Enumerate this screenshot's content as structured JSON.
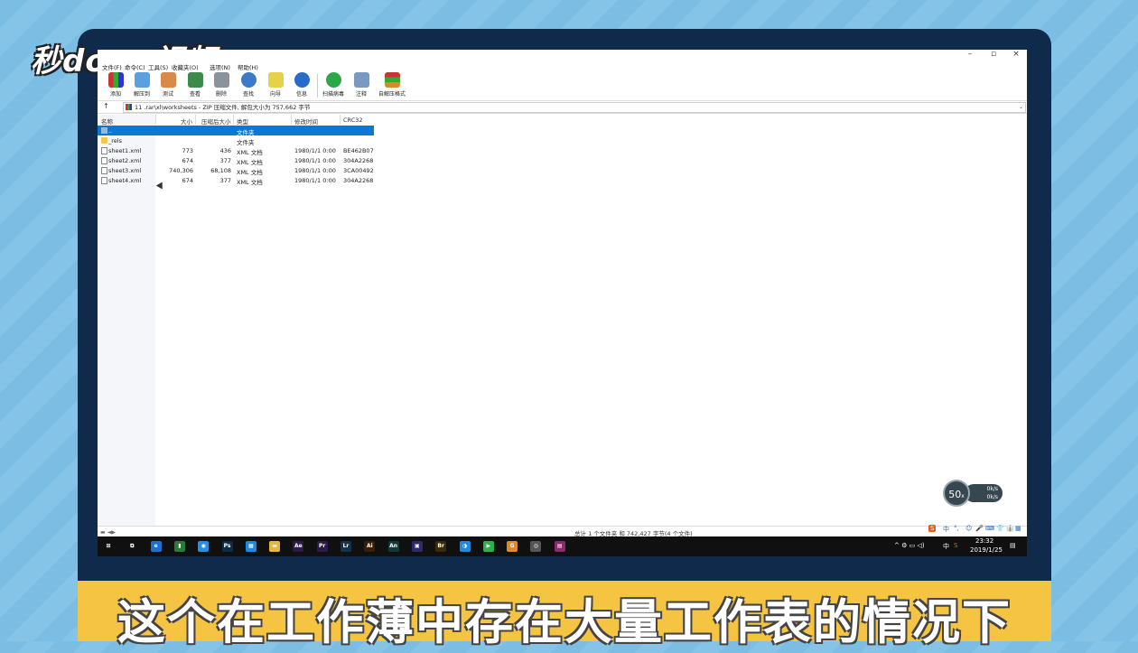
{
  "brand": {
    "logo_text": "秒dong视频"
  },
  "subtitle": "这个在工作薄中存在大量工作表的情况下",
  "window": {
    "controls": {
      "minimize": "–",
      "maximize": "▫",
      "close": "×"
    }
  },
  "menu": {
    "items": [
      "文件(F)",
      "命令(C)",
      "工具(S)",
      "收藏夹(O)",
      "选项(N)",
      "帮助(H)"
    ]
  },
  "toolbar": {
    "tools": [
      {
        "label": "添加",
        "icon": "add-archive-icon"
      },
      {
        "label": "解压到",
        "icon": "extract-to-icon"
      },
      {
        "label": "测试",
        "icon": "test-icon"
      },
      {
        "label": "查看",
        "icon": "view-icon"
      },
      {
        "label": "删除",
        "icon": "delete-icon"
      },
      {
        "label": "查找",
        "icon": "find-icon"
      },
      {
        "label": "向导",
        "icon": "wizard-icon"
      },
      {
        "label": "信息",
        "icon": "info-icon"
      },
      {
        "label": "扫描病毒",
        "icon": "virus-scan-icon"
      },
      {
        "label": "注释",
        "icon": "comment-icon"
      },
      {
        "label": "自解压格式",
        "icon": "sfx-icon"
      }
    ]
  },
  "address": {
    "up_label": "↑",
    "path": "11 .rar\\xl\\worksheets - ZIP 压缩文件, 解包大小为 757,662 字节"
  },
  "columns": [
    "名称",
    "大小",
    "压缩后大小",
    "类型",
    "修改时间",
    "CRC32"
  ],
  "files": [
    {
      "name": "..",
      "size": "",
      "packed": "",
      "type": "文件夹",
      "modified": "",
      "crc": "",
      "kind": "up",
      "selected": true
    },
    {
      "name": "_rels",
      "size": "",
      "packed": "",
      "type": "文件夹",
      "modified": "",
      "crc": "",
      "kind": "folder",
      "selected": false
    },
    {
      "name": "sheet1.xml",
      "size": "773",
      "packed": "436",
      "type": "XML 文档",
      "modified": "1980/1/1 0:00",
      "crc": "BE462B07",
      "kind": "file",
      "selected": false
    },
    {
      "name": "sheet2.xml",
      "size": "674",
      "packed": "377",
      "type": "XML 文档",
      "modified": "1980/1/1 0:00",
      "crc": "304A2268",
      "kind": "file",
      "selected": false
    },
    {
      "name": "sheet3.xml",
      "size": "740,306",
      "packed": "68,108",
      "type": "XML 文档",
      "modified": "1980/1/1 0:00",
      "crc": "3CA00492",
      "kind": "file",
      "selected": false
    },
    {
      "name": "sheet4.xml",
      "size": "674",
      "packed": "377",
      "type": "XML 文档",
      "modified": "1980/1/1 0:00",
      "crc": "304A2268",
      "kind": "file",
      "selected": false
    }
  ],
  "status": {
    "left": "▬ ◄▶",
    "text": "总计 1 个文件夹 和 742,427 字节(4 个文件)"
  },
  "ime": {
    "items": [
      "S",
      "中",
      "°,",
      "☺",
      "🎤",
      "⌨",
      "👕",
      "👔",
      "▦"
    ]
  },
  "taskbar": {
    "apps": [
      {
        "name": "start-icon",
        "label": "⊞",
        "color": "#101010"
      },
      {
        "name": "task-view-icon",
        "label": "⧉",
        "color": "#101010"
      },
      {
        "name": "edge-icon",
        "label": "e",
        "color": "#1f6fd1"
      },
      {
        "name": "terminal-icon",
        "label": "▮",
        "color": "#2a7a3a"
      },
      {
        "name": "chat-icon",
        "label": "◉",
        "color": "#2a8ee0"
      },
      {
        "name": "photoshop-icon",
        "label": "Ps",
        "color": "#0b2d4a"
      },
      {
        "name": "store-icon",
        "label": "▦",
        "color": "#1e88e5"
      },
      {
        "name": "explorer-icon",
        "label": "▬",
        "color": "#e8b63a"
      },
      {
        "name": "after-effects-icon",
        "label": "Ae",
        "color": "#2b1a4a"
      },
      {
        "name": "premiere-icon",
        "label": "Pr",
        "color": "#2b1a4a"
      },
      {
        "name": "lightroom-icon",
        "label": "Lr",
        "color": "#13324a"
      },
      {
        "name": "illustrator-icon",
        "label": "Ai",
        "color": "#3a1e08"
      },
      {
        "name": "animate-icon",
        "label": "An",
        "color": "#0e3b3a"
      },
      {
        "name": "media-encoder-icon",
        "label": "▣",
        "color": "#2c2a6a"
      },
      {
        "name": "bridge-icon",
        "label": "Br",
        "color": "#3a2a06"
      },
      {
        "name": "qq-browser-icon",
        "label": "◑",
        "color": "#1e88e5"
      },
      {
        "name": "media-player-icon",
        "label": "▶",
        "color": "#2ab14a"
      },
      {
        "name": "g-app-icon",
        "label": "G",
        "color": "#e0892a"
      },
      {
        "name": "chrome-icon",
        "label": "◎",
        "color": "#555555"
      },
      {
        "name": "winrar-icon",
        "label": "▤",
        "color": "#8a2a6a"
      }
    ],
    "tray": {
      "icons": "^ ⚙ ▭ ◁)",
      "lang": "中",
      "ime": "S",
      "time": "23:32",
      "date": "2019/1/25",
      "notify": "▤"
    }
  },
  "speed": {
    "percent": "50",
    "unit": "x",
    "up": "0k/s",
    "down": "0k/s"
  }
}
